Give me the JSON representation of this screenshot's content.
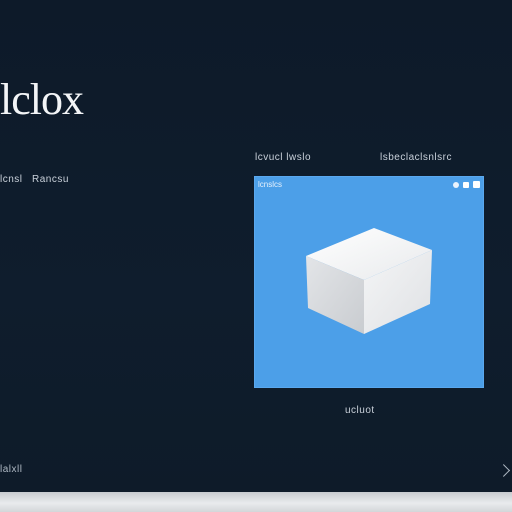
{
  "app": {
    "title": "lclox"
  },
  "labels": {
    "sub_left_a": "lcnsl",
    "sub_left_b": "Rancsu",
    "head_left": "lcvucl lwslo",
    "head_right": "lsbeclaclsnlsrc",
    "caption": "ucluot",
    "foot_left": "lalxll"
  },
  "preview": {
    "header_label": "lcnslcs",
    "background": "#4c9fe8",
    "object": "cube-icon"
  },
  "colors": {
    "screen_bg": "#0f1d2d",
    "preview_bg": "#4c9fe8",
    "bezel": "#e2e5e8"
  }
}
